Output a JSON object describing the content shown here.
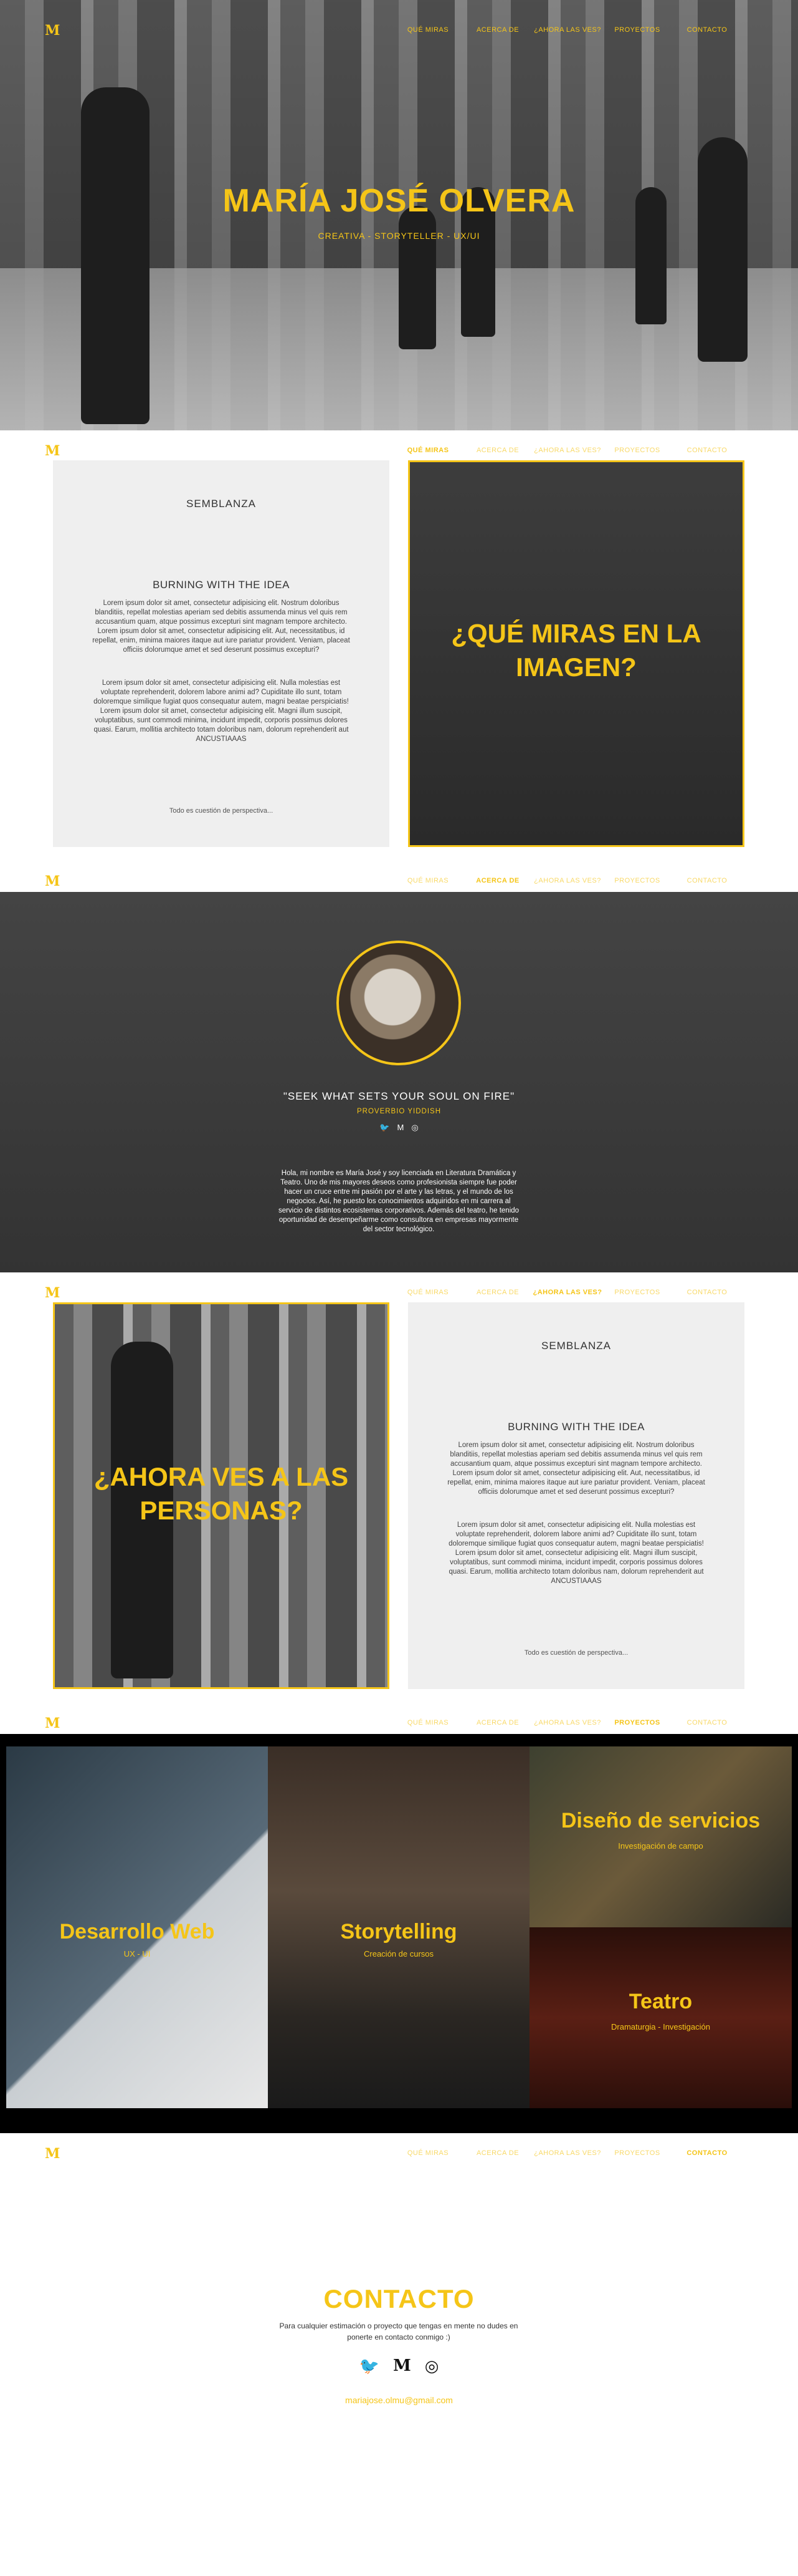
{
  "brand": {
    "logo": "M",
    "accent": "#f5c518"
  },
  "nav": {
    "links": [
      "QUÉ MIRAS",
      "ACERCA DE",
      "¿AHORA LAS VES?",
      "PROYECTOS",
      "CONTACTO"
    ]
  },
  "hero": {
    "title": "MARÍA JOSÉ OLVERA",
    "subtitle": "CREATIVA - STORYTELLER - UX/UI"
  },
  "que_miras": {
    "heading": "SEMBLANZA",
    "subheading": "BURNING WITH THE IDEA",
    "paragraph1": "Lorem ipsum dolor sit amet, consectetur adipisicing elit. Nostrum doloribus blanditiis, repellat molestias aperiam sed debitis assumenda minus vel quis rem accusantium quam, atque possimus excepturi sint magnam tempore architecto. Lorem ipsum dolor sit amet, consectetur adipisicing elit. Aut, necessitatibus, id repellat, enim, minima maiores itaque aut iure pariatur provident. Veniam, placeat officiis dolorumque amet et sed deserunt possimus excepturi?",
    "paragraph2": "Lorem ipsum dolor sit amet, consectetur adipisicing elit. Nulla molestias est voluptate reprehenderit, dolorem labore animi ad? Cupiditate illo sunt, totam doloremque similique fugiat quos consequatur autem, magni beatae perspiciatis! Lorem ipsum dolor sit amet, consectetur adipisicing elit. Magni illum suscipit, voluptatibus, sunt commodi minima, incidunt impedit, corporis possimus dolores quasi. Earum, mollitia architecto totam doloribus nam, dolorum reprehenderit aut ANCUSTIAAAS",
    "footer": "Todo es cuestión de perspectiva...",
    "image_title": "¿QUÉ MIRAS EN LA IMAGEN?"
  },
  "acerca": {
    "quote": "\"SEEK WHAT SETS YOUR SOUL ON FIRE\"",
    "quote_source": "PROVERBIO YIDDISH",
    "social": [
      "twitter-icon",
      "medium-icon",
      "instagram-icon"
    ],
    "social_glyphs": {
      "twitter": "🐦",
      "medium": "M",
      "instagram": "◎"
    },
    "bio": "Hola, mi nombre es María José y soy licenciada en Literatura Dramática y Teatro. Uno de mis mayores deseos como profesionista siempre fue poder hacer un cruce entre mi pasión por el arte y las letras, y el mundo de los negocios. Así, he puesto los conocimientos adquiridos en mi carrera al servicio de distintos ecosistemas corporativos. Además del teatro, he tenido oportunidad de desempeñarme como consultora en empresas mayormente del sector tecnológico."
  },
  "ahora_las_ves": {
    "image_title": "¿AHORA VES A LAS PERSONAS?",
    "heading": "SEMBLANZA",
    "subheading": "BURNING WITH THE IDEA",
    "paragraph1": "Lorem ipsum dolor sit amet, consectetur adipisicing elit. Nostrum doloribus blanditiis, repellat molestias aperiam sed debitis assumenda minus vel quis rem accusantium quam, atque possimus excepturi sint magnam tempore architecto. Lorem ipsum dolor sit amet, consectetur adipisicing elit. Aut, necessitatibus, id repellat, enim, minima maiores itaque aut iure pariatur provident. Veniam, placeat officiis dolorumque amet et sed deserunt possimus excepturi?",
    "paragraph2": "Lorem ipsum dolor sit amet, consectetur adipisicing elit. Nulla molestias est voluptate reprehenderit, dolorem labore animi ad? Cupiditate illo sunt, totam doloremque similique fugiat quos consequatur autem, magni beatae perspiciatis! Lorem ipsum dolor sit amet, consectetur adipisicing elit. Magni illum suscipit, voluptatibus, sunt commodi minima, incidunt impedit, corporis possimus dolores quasi. Earum, mollitia architecto totam doloribus nam, dolorum reprehenderit aut ANCUSTIAAAS",
    "footer": "Todo es cuestión de perspectiva..."
  },
  "proyectos": {
    "tiles": [
      {
        "title": "Desarrollo Web",
        "subtitle": "UX - UI"
      },
      {
        "title": "Storytelling",
        "subtitle": "Creación de cursos"
      },
      {
        "title": "Diseño de servicios",
        "subtitle": "Investigación de campo"
      },
      {
        "title": "Teatro",
        "subtitle": "Dramaturgia - Investigación"
      }
    ]
  },
  "contacto": {
    "title": "CONTACTO",
    "text": "Para cualquier estimación o proyecto que tengas en mente no dudes en ponerte en contacto conmigo :)",
    "social_glyphs": {
      "twitter": "🐦",
      "medium": "M",
      "instagram": "◎"
    },
    "email": "mariajose.olmu@gmail.com"
  }
}
